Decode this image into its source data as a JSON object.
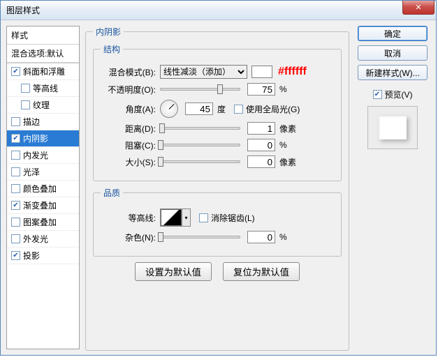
{
  "title": "图层样式",
  "closeGlyph": "✕",
  "sidebar": {
    "header": "样式",
    "blendopt": "混合选项:默认",
    "items": [
      {
        "label": "斜面和浮雕",
        "checked": true
      },
      {
        "label": "等高线",
        "checked": false
      },
      {
        "label": "纹理",
        "checked": false
      },
      {
        "label": "描边",
        "checked": false
      },
      {
        "label": "内阴影",
        "checked": true,
        "selected": true
      },
      {
        "label": "内发光",
        "checked": false
      },
      {
        "label": "光泽",
        "checked": false
      },
      {
        "label": "颜色叠加",
        "checked": false
      },
      {
        "label": "渐变叠加",
        "checked": true
      },
      {
        "label": "图案叠加",
        "checked": false
      },
      {
        "label": "外发光",
        "checked": false
      },
      {
        "label": "投影",
        "checked": true
      }
    ]
  },
  "panel": {
    "title": "内阴影",
    "group_structure": "结构",
    "blendmode_label": "混合模式(B):",
    "blendmode_value": "线性减淡（添加）",
    "hex": "#ffffff",
    "opacity_label": "不透明度(O):",
    "opacity_value": "75",
    "opacity_unit": "%",
    "angle_label": "角度(A):",
    "angle_value": "45",
    "angle_unit": "度",
    "globallight": "使用全局光(G)",
    "distance_label": "距离(D):",
    "distance_value": "1",
    "choke_label": "阻塞(C):",
    "choke_value": "0",
    "size_label": "大小(S):",
    "size_value": "0",
    "px": "像素",
    "pct": "%",
    "group_quality": "品质",
    "contour_label": "等高线:",
    "antialias": "消除锯齿(L)",
    "noise_label": "杂色(N):",
    "noise_value": "0",
    "noise_unit": "%",
    "make_default": "设置为默认值",
    "reset_default": "复位为默认值"
  },
  "right": {
    "ok": "确定",
    "cancel": "取消",
    "newstyle": "新建样式(W)...",
    "preview": "预览(V)"
  }
}
